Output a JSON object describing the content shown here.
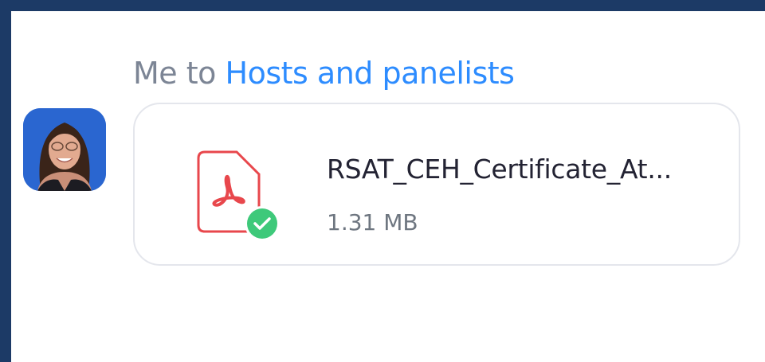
{
  "chat": {
    "sender_me": "Me",
    "sender_to": "to",
    "recipient": "Hosts and panelists"
  },
  "message": {
    "file_name": "RSAT_CEH_Certificate_At...",
    "file_size": "1.31 MB",
    "file_icon": "pdf-file-icon",
    "status_icon": "check-circle-icon",
    "status_color": "#3ec97a",
    "icon_color": "#e8474c"
  },
  "avatar": {
    "icon": "user-avatar"
  },
  "colors": {
    "frame": "#1c3a66",
    "link": "#2d8cff",
    "muted": "#7c8595"
  }
}
